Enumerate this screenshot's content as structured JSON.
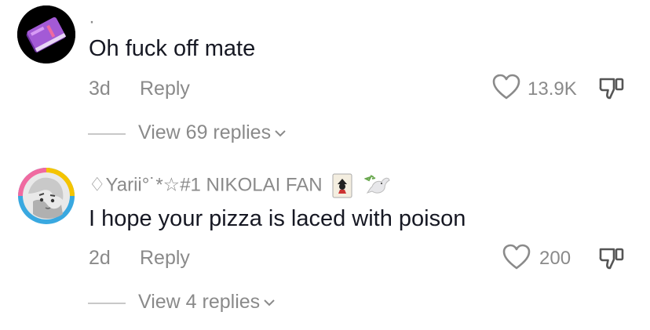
{
  "comments": [
    {
      "username": "·",
      "text": "Oh fuck off mate",
      "time": "3d",
      "reply_label": "Reply",
      "likes": "13.9K",
      "view_replies": "View 69 replies",
      "avatar_icon": "purple-book-icon"
    },
    {
      "username": "♢Yarii°˙*☆#1 NIKOLAI FAN",
      "text": "I hope your pizza is laced with poison",
      "time": "2d",
      "reply_label": "Reply",
      "likes": "200",
      "view_replies": "View 4 replies",
      "avatar_icon": "anime-character-avatar",
      "badges": [
        "joker-card-icon",
        "dove-with-olive-branch-icon"
      ]
    }
  ],
  "colors": {
    "text": "#161823",
    "secondary": "#8a8a8a",
    "book_purple": "#a35ad6",
    "ring_yellow": "#f5c400",
    "ring_pink": "#f06aa0",
    "ring_blue": "#39a8e0"
  }
}
